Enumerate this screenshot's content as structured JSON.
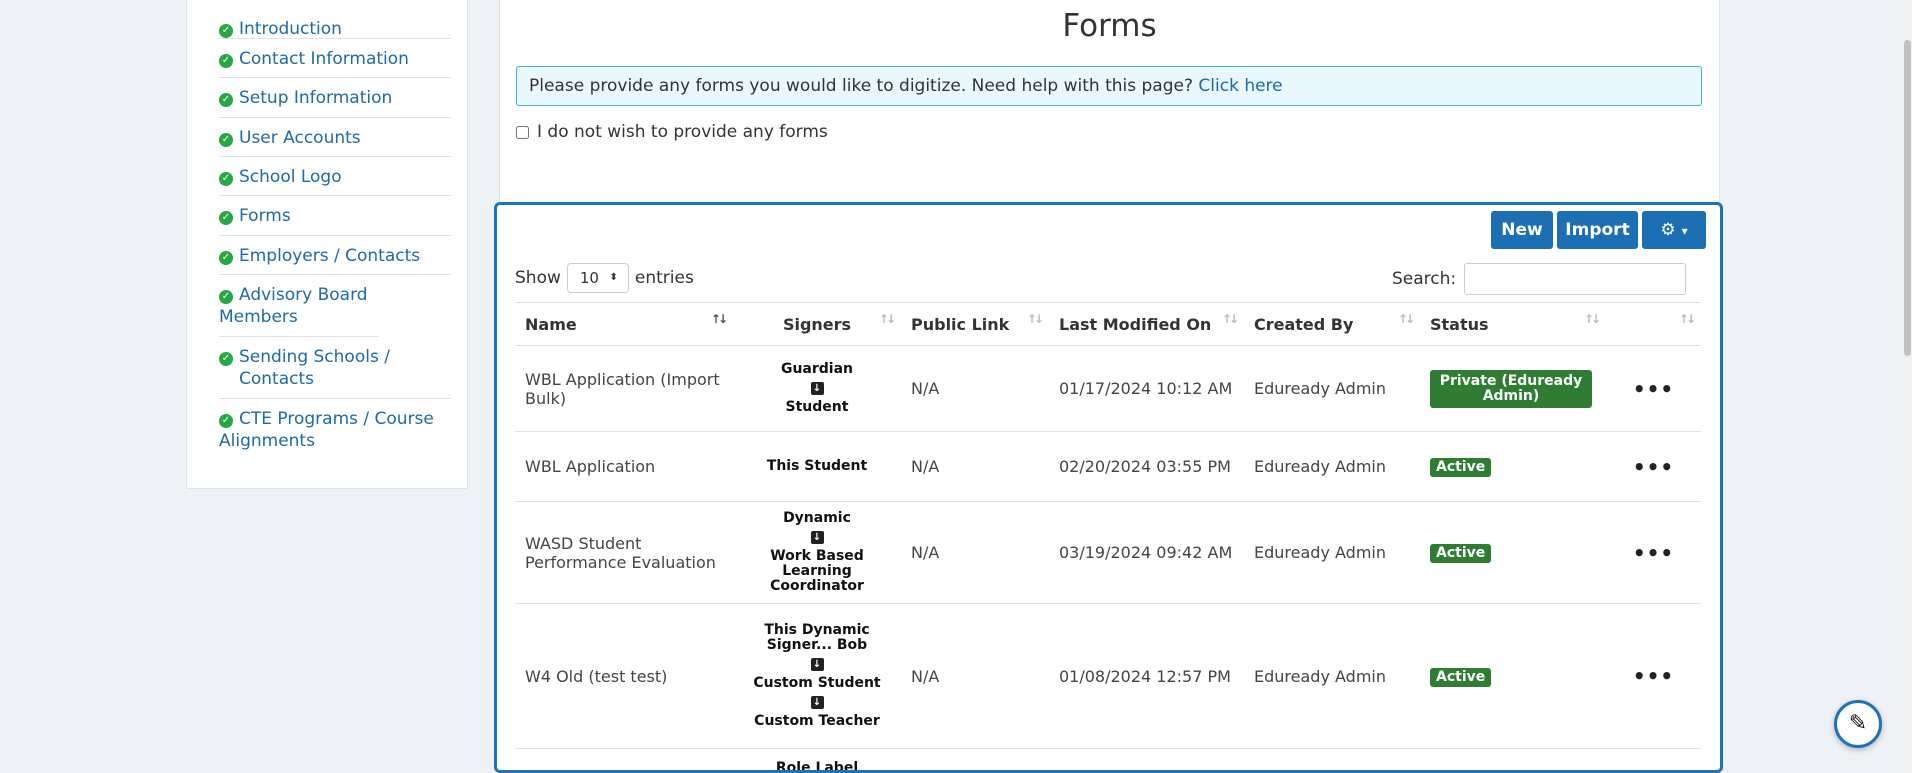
{
  "sidebar": {
    "items": [
      {
        "label": "Introduction"
      },
      {
        "label": "Contact Information"
      },
      {
        "label": "Setup Information"
      },
      {
        "label": "User Accounts"
      },
      {
        "label": "School Logo"
      },
      {
        "label": "Forms"
      },
      {
        "label": "Employers / Contacts"
      },
      {
        "label": "Advisory Board Members"
      },
      {
        "label": "Sending Schools / Contacts"
      },
      {
        "label": "CTE Programs / Course Alignments"
      }
    ]
  },
  "main": {
    "title": "Forms",
    "info_text": "Please provide any forms you would like to digitize. Need help with this page?",
    "info_link": "Click here",
    "optout_label": "I do not wish to provide any forms"
  },
  "toolbar": {
    "new_label": "New",
    "import_label": "Import",
    "gear_caret": "▾"
  },
  "table_controls": {
    "show_label": "Show",
    "entries_value": "10",
    "entries_label": "entries",
    "search_label": "Search:"
  },
  "table": {
    "headers": [
      "Name",
      "Signers",
      "Public Link",
      "Last Modified On",
      "Created By",
      "Status",
      ""
    ],
    "rows": [
      {
        "name": "WBL Application (Import Bulk)",
        "signers": [
          "Guardian",
          "Student"
        ],
        "public_link": "N/A",
        "modified": "01/17/2024 10:12 AM",
        "created_by": "Eduready Admin",
        "status": "Private (Eduready Admin)"
      },
      {
        "name": "WBL Application",
        "signers": [
          "This Student"
        ],
        "public_link": "N/A",
        "modified": "02/20/2024 03:55 PM",
        "created_by": "Eduready Admin",
        "status": "Active"
      },
      {
        "name": "WASD Student Performance Evaluation",
        "signers": [
          "Dynamic",
          "Work Based Learning Coordinator"
        ],
        "public_link": "N/A",
        "modified": "03/19/2024 09:42 AM",
        "created_by": "Eduready Admin",
        "status": "Active"
      },
      {
        "name": "W4 Old (test test)",
        "signers": [
          "This Dynamic Signer... Bob",
          "Custom Student",
          "Custom Teacher"
        ],
        "public_link": "N/A",
        "modified": "01/08/2024 12:57 PM",
        "created_by": "Eduready Admin",
        "status": "Active"
      },
      {
        "name": "",
        "signers": [
          "Role Label"
        ],
        "public_link": "",
        "modified": "",
        "created_by": "",
        "status": ""
      }
    ]
  },
  "colors": {
    "primary": "#1d6fb4",
    "success": "#2e7d32",
    "info_bg": "#e9f8fc",
    "link": "#1e6aa8"
  },
  "icons": {
    "check": "check-circle-icon",
    "gear": "gears-icon",
    "arrow_down": "arrow-down-box-icon",
    "more": "ellipsis-icon",
    "help": "pen-icon"
  }
}
